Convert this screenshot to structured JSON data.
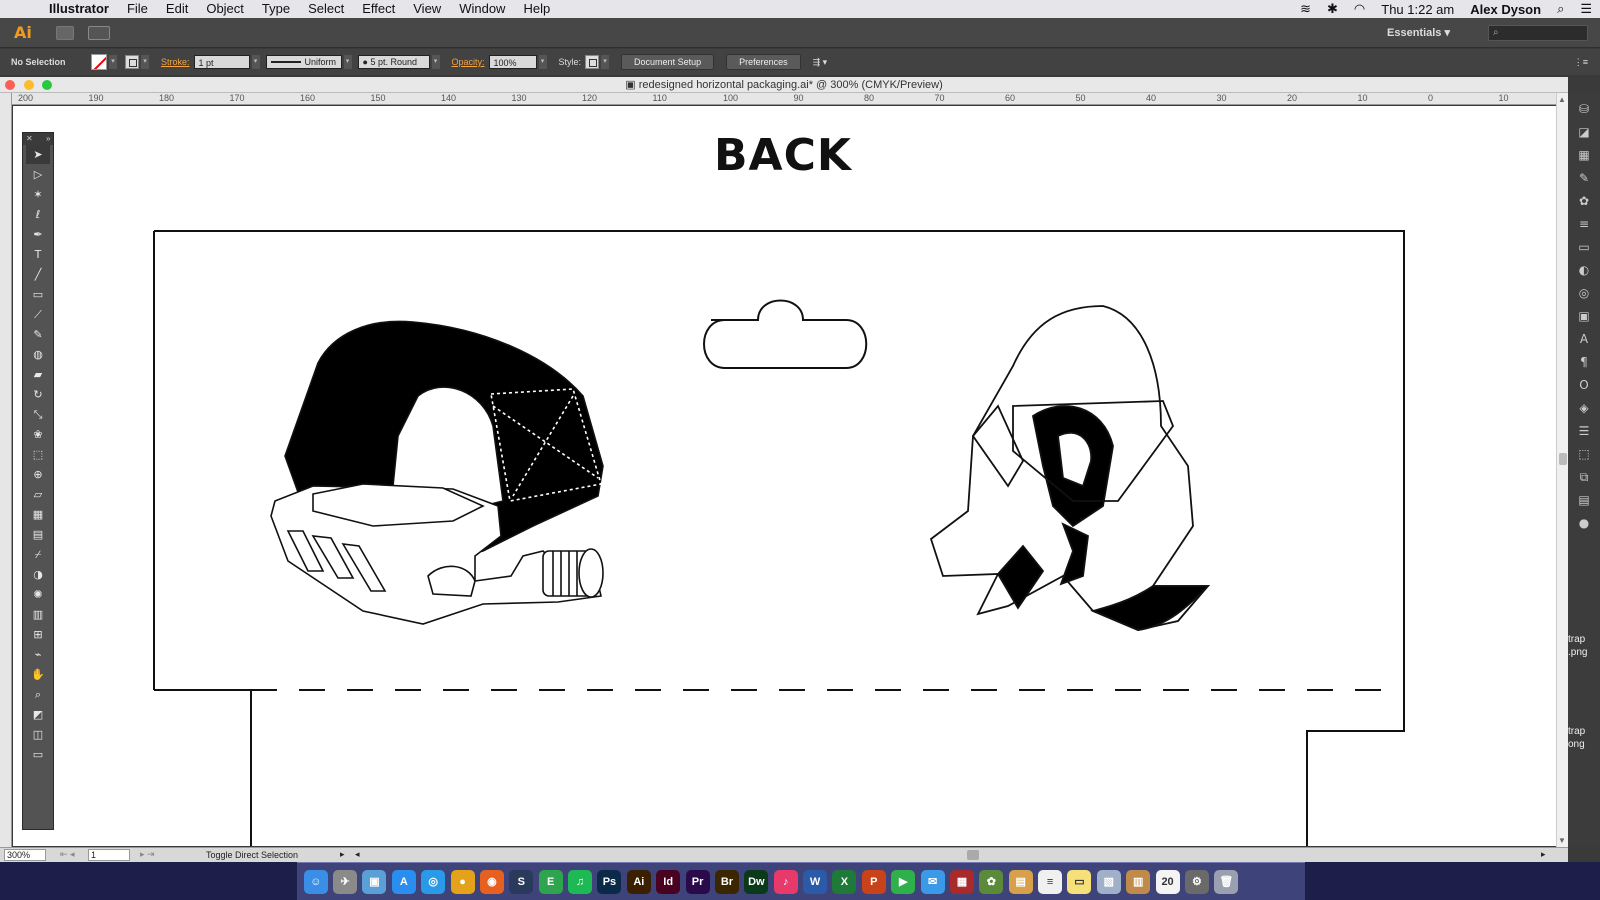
{
  "menubar": {
    "apple": "",
    "app_name": "Illustrator",
    "items": [
      "File",
      "Edit",
      "Object",
      "Type",
      "Select",
      "Effect",
      "View",
      "Window",
      "Help"
    ],
    "clock": "Thu 1:22 am",
    "user": "Alex Dyson"
  },
  "appbar": {
    "logo": "Ai",
    "workspace": "Essentials",
    "search_placeholder": "⌕"
  },
  "control": {
    "selection": "No Selection",
    "stroke_label": "Stroke:",
    "stroke_value": "1 pt",
    "profile": "Uniform",
    "brush": "5 pt. Round",
    "opacity_label": "Opacity:",
    "opacity_value": "100%",
    "style_label": "Style:",
    "doc_setup": "Document Setup",
    "preferences": "Preferences",
    "fill_color": "#ffffff",
    "accent_orange": "#f5a33a"
  },
  "document": {
    "title": "redesigned horizontal packaging.ai* @ 300% (CMYK/Preview)",
    "ruler_ticks": [
      "200",
      "190",
      "180",
      "170",
      "160",
      "150",
      "140",
      "130",
      "120",
      "110",
      "100",
      "90",
      "80",
      "70",
      "60",
      "50",
      "40",
      "30",
      "20",
      "10",
      "0",
      "10"
    ],
    "artboard_heading": "BACK"
  },
  "tools": [
    "selection-icon",
    "direct-selection-icon",
    "magic-wand-icon",
    "lasso-icon",
    "pen-icon",
    "type-icon",
    "line-icon",
    "rectangle-icon",
    "paintbrush-icon",
    "pencil-icon",
    "blob-brush-icon",
    "eraser-icon",
    "rotate-icon",
    "scale-icon",
    "warp-icon",
    "free-transform-icon",
    "shape-builder-icon",
    "perspective-icon",
    "mesh-icon",
    "gradient-icon",
    "eyedropper-icon",
    "blend-icon",
    "symbol-sprayer-icon",
    "graph-icon",
    "artboard-icon",
    "slice-icon",
    "hand-icon",
    "zoom-icon"
  ],
  "right_dock": {
    "file_label_1": "trap\n.png",
    "file_label_2": "trap\nong"
  },
  "status": {
    "zoom": "300%",
    "page": "1",
    "text": "Toggle Direct Selection"
  },
  "dock": {
    "apps": [
      {
        "name": "finder",
        "label": "☺",
        "color": "#3a8ee6"
      },
      {
        "name": "launchpad",
        "label": "✈",
        "color": "#8a8a8a"
      },
      {
        "name": "preview",
        "label": "▣",
        "color": "#5aa0d6"
      },
      {
        "name": "app-store",
        "label": "A",
        "color": "#2a8ef0"
      },
      {
        "name": "safari",
        "label": "◎",
        "color": "#2a9ae8"
      },
      {
        "name": "chrome",
        "label": "●",
        "color": "#e3a21a"
      },
      {
        "name": "firefox",
        "label": "◉",
        "color": "#e66020"
      },
      {
        "name": "steam",
        "label": "S",
        "color": "#2a3a5a"
      },
      {
        "name": "evernote",
        "label": "E",
        "color": "#2fa44f"
      },
      {
        "name": "spotify",
        "label": "♫",
        "color": "#1db954"
      },
      {
        "name": "photoshop",
        "label": "Ps",
        "color": "#0b2a4a"
      },
      {
        "name": "illustrator",
        "label": "Ai",
        "color": "#3a1f00"
      },
      {
        "name": "indesign",
        "label": "Id",
        "color": "#49021f"
      },
      {
        "name": "premiere",
        "label": "Pr",
        "color": "#2a0a4a"
      },
      {
        "name": "bridge",
        "label": "Br",
        "color": "#3a2600"
      },
      {
        "name": "dreamweaver",
        "label": "Dw",
        "color": "#0a3a1a"
      },
      {
        "name": "itunes",
        "label": "♪",
        "color": "#e83a6a"
      },
      {
        "name": "word",
        "label": "W",
        "color": "#2a5aa8"
      },
      {
        "name": "excel",
        "label": "X",
        "color": "#1f7a3a"
      },
      {
        "name": "powerpoint",
        "label": "P",
        "color": "#c8421a"
      },
      {
        "name": "facetime",
        "label": "▶",
        "color": "#2fb04a"
      },
      {
        "name": "messages",
        "label": "✉",
        "color": "#3a9ae8"
      },
      {
        "name": "photo-booth",
        "label": "▦",
        "color": "#a82a2a"
      },
      {
        "name": "iphoto",
        "label": "✿",
        "color": "#5a8a3a"
      },
      {
        "name": "ibooks",
        "label": "▤",
        "color": "#d8a04a"
      },
      {
        "name": "notes",
        "label": "≡",
        "color": "#f0f0f0"
      },
      {
        "name": "stickies",
        "label": "▭",
        "color": "#f5e07a"
      },
      {
        "name": "preview-2",
        "label": "▧",
        "color": "#a0b0c8"
      },
      {
        "name": "ibooks-2",
        "label": "▥",
        "color": "#c08a4a"
      },
      {
        "name": "calendar",
        "label": "20",
        "color": "#f4f4f4"
      },
      {
        "name": "system-preferences",
        "label": "⚙",
        "color": "#6a6a6a"
      },
      {
        "name": "trash",
        "label": "🗑",
        "color": "#9aa0b0"
      }
    ]
  }
}
